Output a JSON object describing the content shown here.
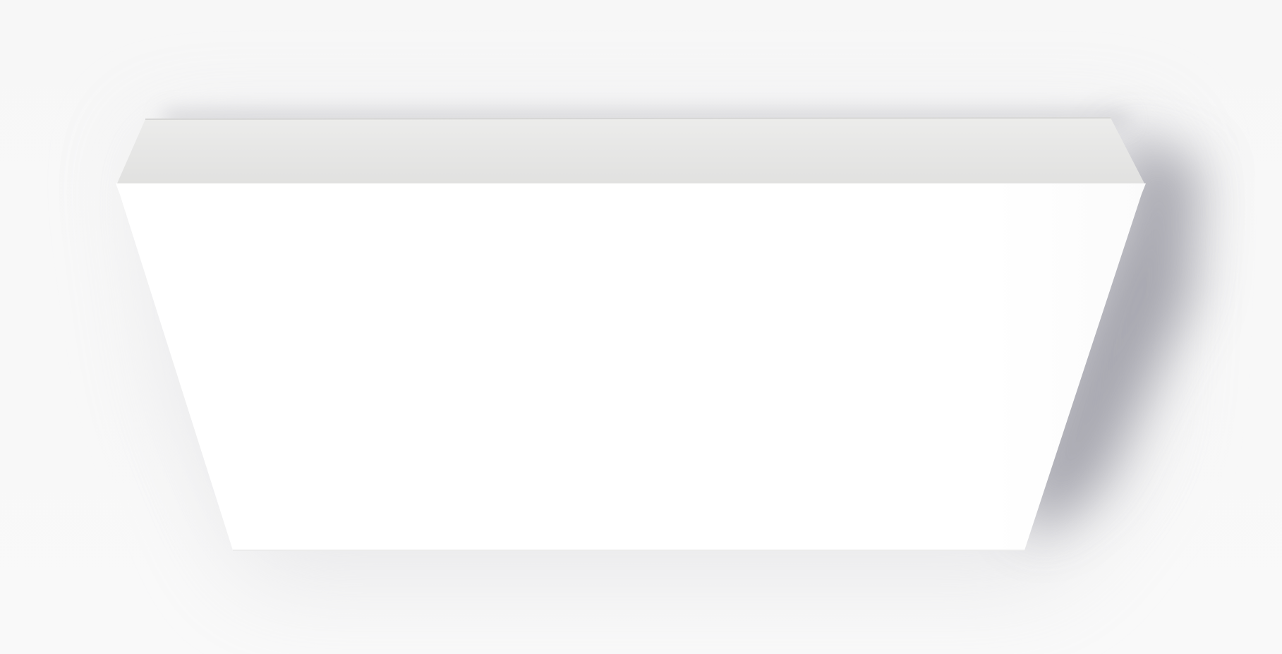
{
  "scene": {
    "subject": "ceiling-light-panel",
    "colors": {
      "background": "#f8f8f8",
      "top_face": "#e3e3e2",
      "top_face_highlight": "#ececeb",
      "front_face": "#ffffff",
      "edge_line": "#d9d9d8",
      "shadow": "#9b9ba4"
    }
  }
}
